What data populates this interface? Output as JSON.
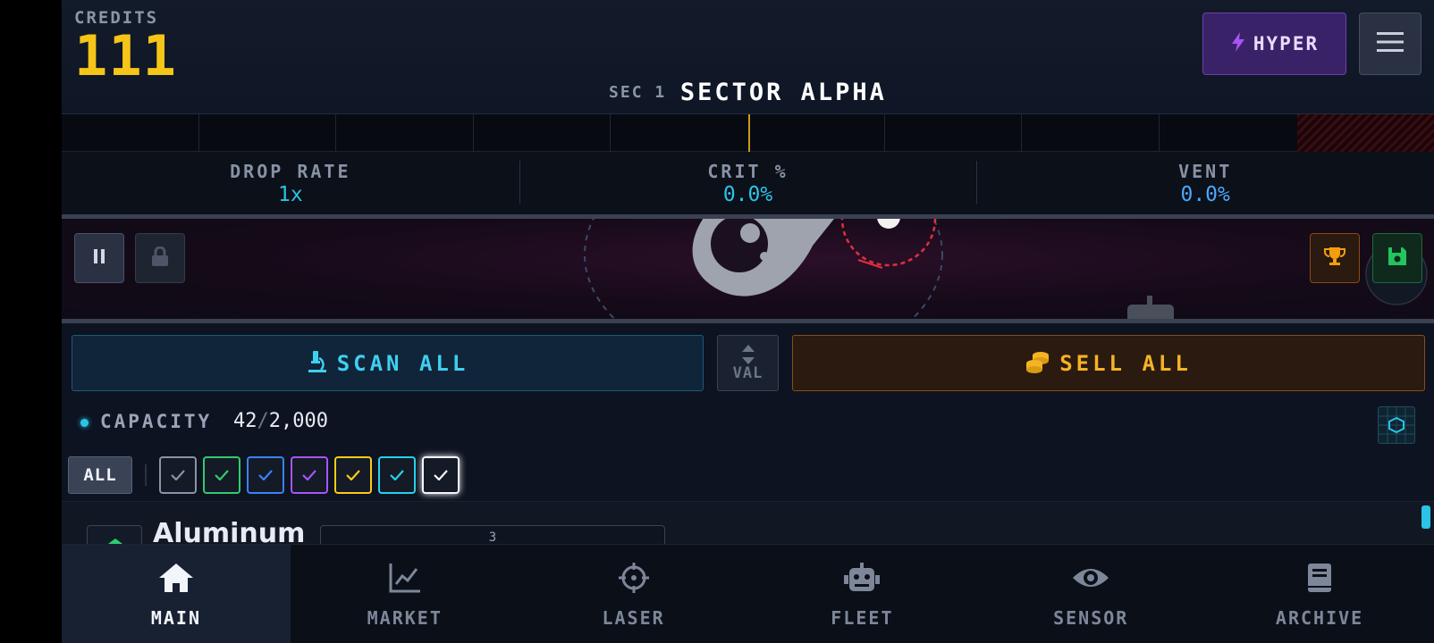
{
  "header": {
    "credits_label": "CREDITS",
    "credits_value": "111",
    "sector_prefix": "SEC 1",
    "sector_name": "SECTOR ALPHA",
    "hyper_label": "HYPER",
    "hyper_icon": "bolt-icon",
    "menu_icon": "hamburger-menu-icon"
  },
  "stats": [
    {
      "label": "DROP RATE",
      "value": "1x"
    },
    {
      "label": "CRIT %",
      "value": "0.0%"
    },
    {
      "label": "VENT",
      "value": "0.0%"
    }
  ],
  "viewport": {
    "pause_icon": "pause-icon",
    "lock_icon": "lock-icon",
    "trophy_icon": "trophy-icon",
    "save_icon": "save-icon"
  },
  "actions": {
    "scan_label": "SCAN ALL",
    "scan_icon": "microscope-icon",
    "sort_label": "VAL",
    "sort_icon": "sort-icon",
    "sell_label": "SELL ALL",
    "sell_icon": "coins-icon"
  },
  "capacity": {
    "label": "CAPACITY",
    "current": "42",
    "separator": "/",
    "max": "2,000"
  },
  "filters": {
    "all_label": "ALL",
    "rarity_colors": [
      "#8a93a6",
      "#2ecc71",
      "#3b82f6",
      "#a855f7",
      "#facc15",
      "#22d3ee",
      "#f5f7fa"
    ]
  },
  "list": {
    "first_item_name": "Aluminum",
    "first_item_field": "3"
  },
  "nav": [
    {
      "label": "MAIN",
      "icon": "home-icon",
      "active": true
    },
    {
      "label": "MARKET",
      "icon": "chart-icon",
      "active": false
    },
    {
      "label": "LASER",
      "icon": "crosshair-icon",
      "active": false
    },
    {
      "label": "FLEET",
      "icon": "robot-icon",
      "active": false
    },
    {
      "label": "SENSOR",
      "icon": "eye-icon",
      "active": false
    },
    {
      "label": "ARCHIVE",
      "icon": "book-icon",
      "active": false
    }
  ],
  "colors": {
    "credits": "#f5c518",
    "stat_value": "#2bc3e8",
    "scan": "#3fcff0",
    "sell": "#f5b324",
    "hyper_bg": "#3a2268"
  }
}
